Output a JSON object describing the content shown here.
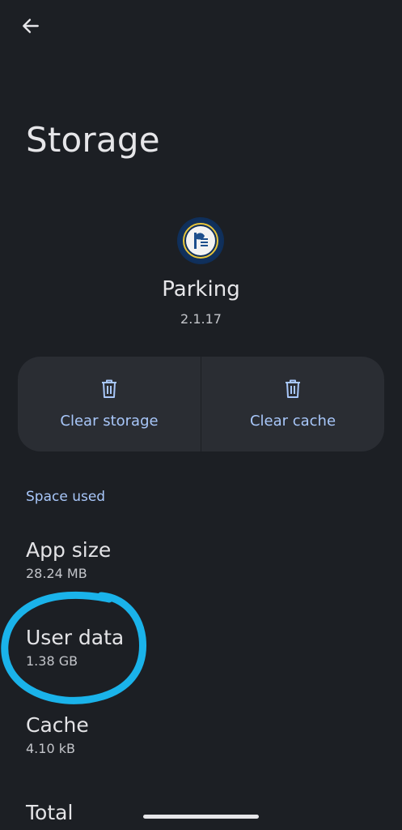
{
  "header": {
    "back_icon": "arrow-left-icon",
    "title": "Storage"
  },
  "app": {
    "name": "Parking",
    "version": "2.1.17",
    "icon": "app-logo-icon"
  },
  "actions": {
    "clear_storage": {
      "label": "Clear storage",
      "icon": "trash-icon"
    },
    "clear_cache": {
      "label": "Clear cache",
      "icon": "trash-icon"
    }
  },
  "space_used": {
    "header": "Space used",
    "items": [
      {
        "title": "App size",
        "value": "28.24 MB"
      },
      {
        "title": "User data",
        "value": "1.38 GB"
      },
      {
        "title": "Cache",
        "value": "4.10 kB"
      },
      {
        "title": "Total",
        "value": ""
      }
    ]
  },
  "colors": {
    "background": "#1c1f24",
    "card": "#2a2d33",
    "accent": "#a8c7fa",
    "annotation": "#1ab3ea"
  }
}
